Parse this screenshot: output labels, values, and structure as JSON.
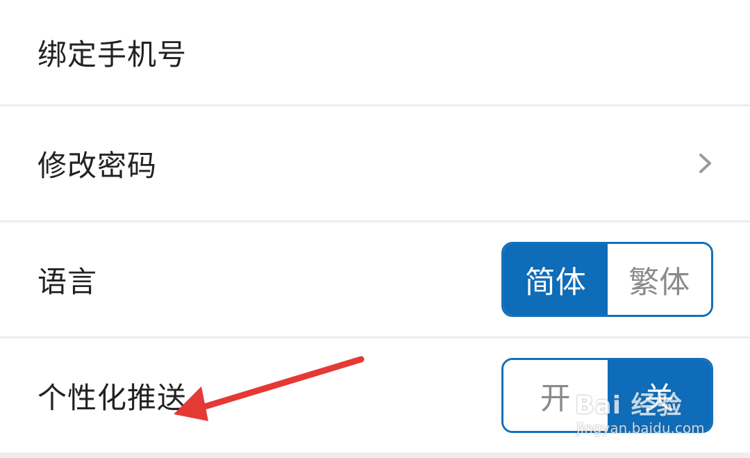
{
  "settings": {
    "rows": [
      {
        "label": "绑定手机号"
      },
      {
        "label": "修改密码"
      },
      {
        "label": "语言",
        "options": [
          "简体",
          "繁体"
        ],
        "selected": "简体"
      },
      {
        "label": "个性化推送",
        "options": [
          "开",
          "关"
        ],
        "selected": "关"
      }
    ]
  },
  "watermark": {
    "logo_text": "Bai 经验",
    "url": "jingyan.baidu.com"
  },
  "colors": {
    "accent": "#0e6cb8",
    "annotation_arrow": "#e53935",
    "divider": "#eeeeee"
  },
  "icons": {
    "chevron": "chevron-right-icon",
    "arrow": "annotation-arrow-icon"
  }
}
